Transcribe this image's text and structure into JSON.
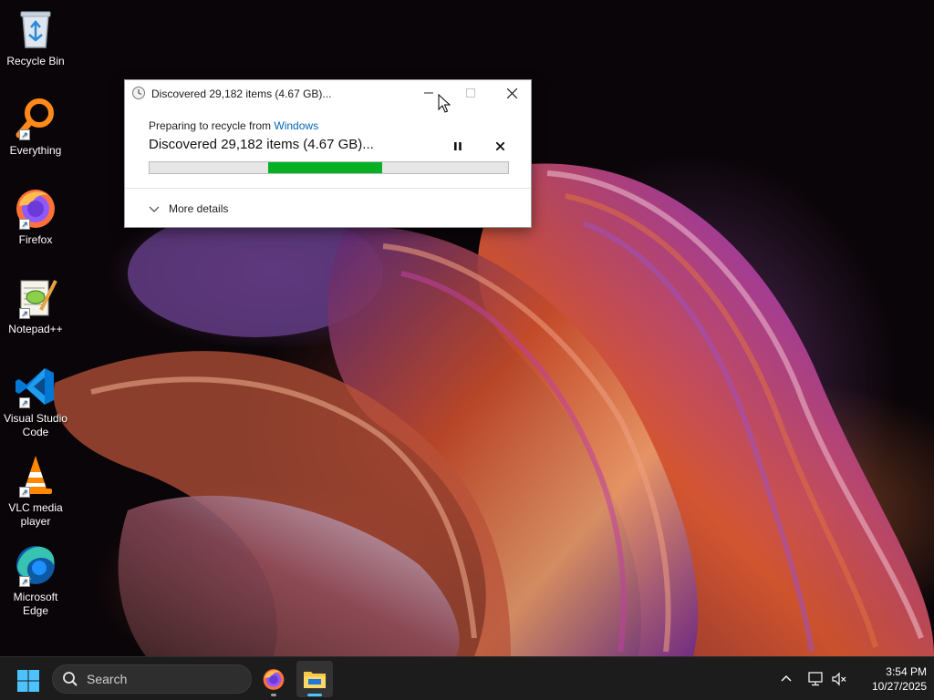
{
  "desktop": {
    "icons": [
      {
        "label": "Recycle Bin",
        "icon": "recycle-bin-icon"
      },
      {
        "label": "Everything",
        "icon": "everything-icon"
      },
      {
        "label": "Firefox",
        "icon": "firefox-icon"
      },
      {
        "label": "Notepad++",
        "icon": "notepad-plus-plus-icon"
      },
      {
        "label": "Visual Studio Code",
        "icon": "vscode-icon"
      },
      {
        "label": "VLC media player",
        "icon": "vlc-icon"
      },
      {
        "label": "Microsoft Edge",
        "icon": "edge-icon"
      }
    ]
  },
  "dialog": {
    "title": "Discovered 29,182 items (4.67 GB)...",
    "preparing_prefix": "Preparing to recycle from ",
    "preparing_source": "Windows",
    "status": "Discovered 29,182 items (4.67 GB)...",
    "progress": {
      "start_fraction": 0.33,
      "end_fraction": 0.65,
      "mode": "indeterminate"
    },
    "more_details_label": "More details",
    "progress_color": "#06b025",
    "link_color": "#0066b4"
  },
  "taskbar": {
    "search_placeholder": "Search",
    "apps": [
      {
        "name": "Firefox",
        "icon": "firefox-icon",
        "active": false
      },
      {
        "name": "File Explorer",
        "icon": "file-explorer-icon",
        "active": true
      }
    ],
    "time": "3:54 PM",
    "date": "10/27/2025",
    "accent_color": "#4cc2ff"
  }
}
